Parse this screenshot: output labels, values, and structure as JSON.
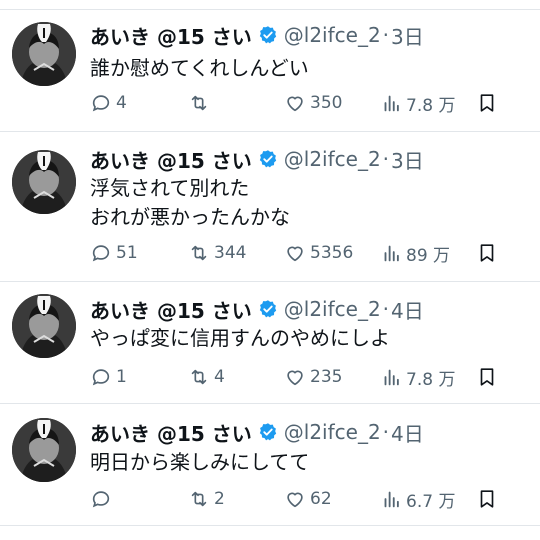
{
  "tweets": [
    {
      "name": "あいき @15 さい",
      "handle": "@l2ifce_2",
      "separator": "·",
      "time": "3日",
      "text": "誰か慰めてくれしんどい",
      "replies": "4",
      "retweets": "",
      "likes": "350",
      "views": "7.8 万"
    },
    {
      "name": "あいき @15 さい",
      "handle": "@l2ifce_2",
      "separator": "·",
      "time": "3日",
      "text": "浮気されて別れた\nおれが悪かったんかな",
      "replies": "51",
      "retweets": "344",
      "likes": "5356",
      "views": "89 万"
    },
    {
      "name": "あいき @15 さい",
      "handle": "@l2ifce_2",
      "separator": "·",
      "time": "4日",
      "text": "やっぱ変に信用すんのやめにしよ",
      "replies": "1",
      "retweets": "4",
      "likes": "235",
      "views": "7.8 万"
    },
    {
      "name": "あいき @15 さい",
      "handle": "@l2ifce_2",
      "separator": "·",
      "time": "4日",
      "text": "明日から楽しみにしてて",
      "replies": "",
      "retweets": "2",
      "likes": "62",
      "views": "6.7 万"
    }
  ],
  "colors": {
    "text": "#0f1419",
    "secondary": "#536471",
    "verified": "#1d9bf0",
    "divider": "#e2e6ea"
  },
  "icons": [
    "avatar",
    "verified-badge-icon",
    "reply-icon",
    "retweet-icon",
    "like-icon",
    "views-icon",
    "bookmark-icon"
  ]
}
